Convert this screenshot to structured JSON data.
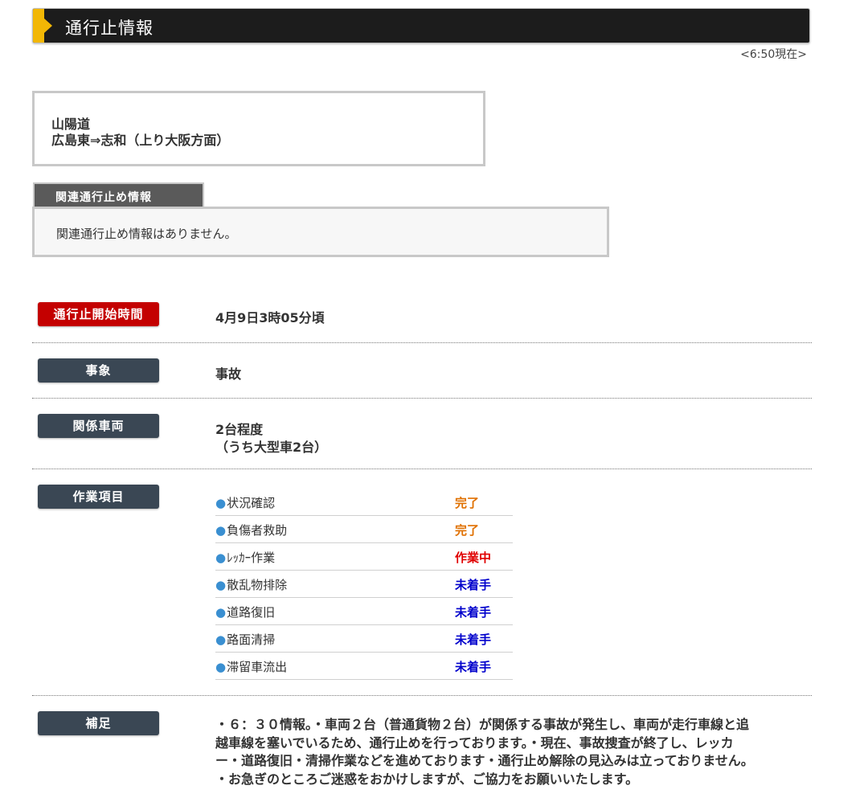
{
  "header": {
    "title": "通行止情報",
    "timestamp": "<6:50現在>"
  },
  "route": {
    "road": "山陽道",
    "section": "広島東⇒志和（上り大阪方面）"
  },
  "related": {
    "tab_label": "関連通行止め情報",
    "message": "関連通行止め情報はありません。"
  },
  "details": {
    "start": {
      "label": "通行止開始時間",
      "value": "4月9日3時05分頃"
    },
    "event": {
      "label": "事象",
      "value": "事故"
    },
    "vehicles": {
      "label": "関係車両",
      "line1": "2台程度",
      "line2": "（うち大型車2台）"
    },
    "tasks_label": "作業項目",
    "supplement": {
      "label": "補足",
      "lines": [
        "・６：３０情報。・車両２台（普通貨物２台）が関係する事故が発生し、車両が走行車線と追",
        "越車線を塞いでいるため、通行止めを行っております。・現在、事故捜査が終了し、レッカ",
        "ー・道路復旧・清掃作業などを進めております・通行止め解除の見込みは立っておりません。",
        "・お急ぎのところご迷惑をおかけしますが、ご協力をお願いいたします。"
      ]
    }
  },
  "tasks": [
    {
      "name": "状況確認",
      "status": "完了",
      "color": "#e07000"
    },
    {
      "name": "負傷者救助",
      "status": "完了",
      "color": "#e07000"
    },
    {
      "name": "ﾚｯｶｰ作業",
      "status": "作業中",
      "color": "#e00000"
    },
    {
      "name": "散乱物排除",
      "status": "未着手",
      "color": "#0000cc"
    },
    {
      "name": "道路復旧",
      "status": "未着手",
      "color": "#0000cc"
    },
    {
      "name": "路面清掃",
      "status": "未着手",
      "color": "#0000cc"
    },
    {
      "name": "滞留車流出",
      "status": "未着手",
      "color": "#0000cc"
    }
  ]
}
